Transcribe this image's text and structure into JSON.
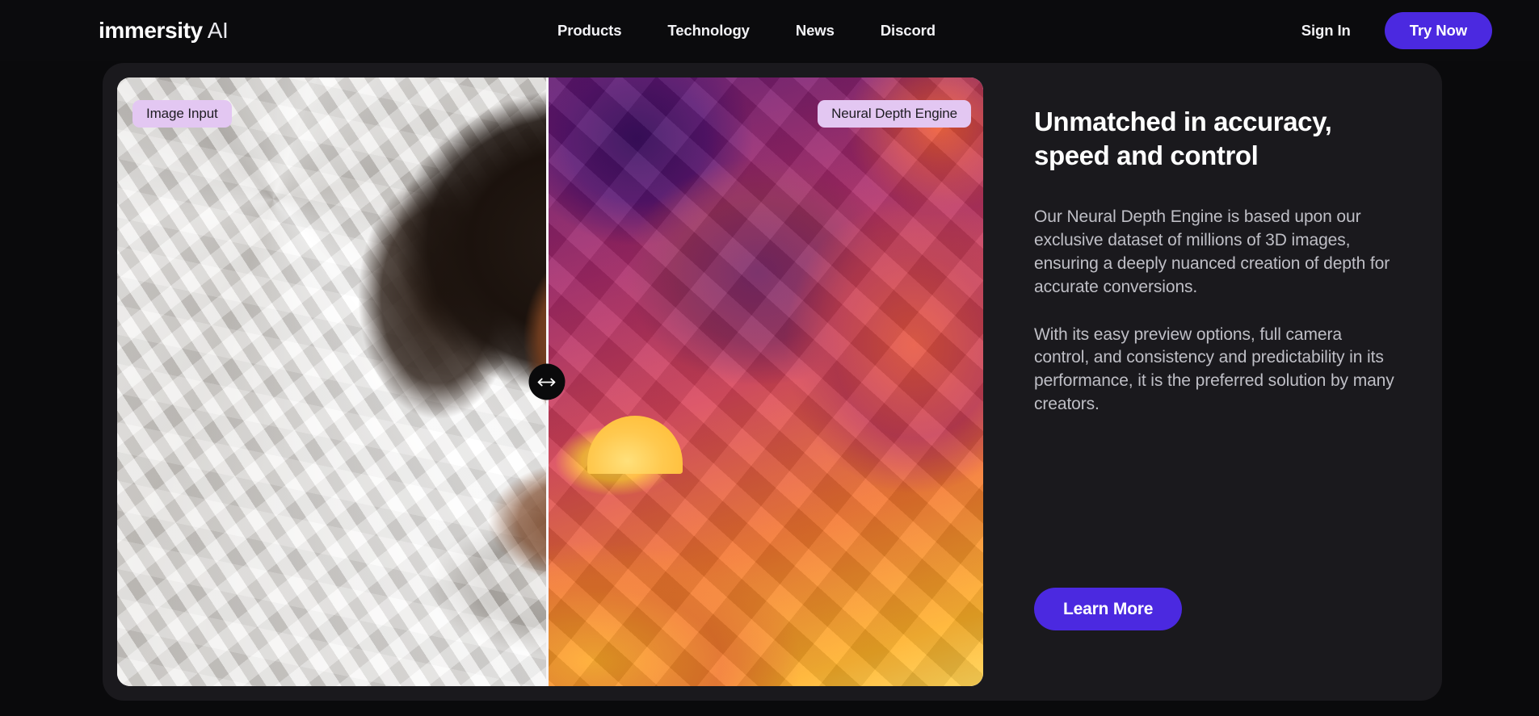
{
  "brand": {
    "name_strong": "immersity",
    "name_light": "AI"
  },
  "nav": {
    "links": [
      {
        "label": "Products"
      },
      {
        "label": "Technology"
      },
      {
        "label": "News"
      },
      {
        "label": "Discord"
      }
    ],
    "sign_in_label": "Sign In",
    "try_now_label": "Try Now",
    "accent_color": "#4b29e0"
  },
  "comparison": {
    "left_badge": "Image Input",
    "right_badge": "Neural Depth Engine",
    "badge_background": "#e3c7f2",
    "badge_text_color": "#1e1c22",
    "handle_icon": "left-right-arrow-icon",
    "split_position": "49.6%"
  },
  "panel": {
    "title": "Unmatched in accuracy, speed and control",
    "paragraph_1": "Our Neural Depth Engine is based upon our exclusive dataset of millions of 3D images, ensuring a deeply nuanced creation of depth for accurate conversions.",
    "paragraph_2": "With its easy preview options, full camera control, and consistency and predictability in its performance, it is the preferred solution by many creators.",
    "cta_label": "Learn More",
    "cta_color": "#4b29e0",
    "title_color": "#ffffff",
    "body_color": "#bfbfc6"
  },
  "theme": {
    "page_background": "#0a0a0c",
    "card_background": "#1a191d"
  }
}
